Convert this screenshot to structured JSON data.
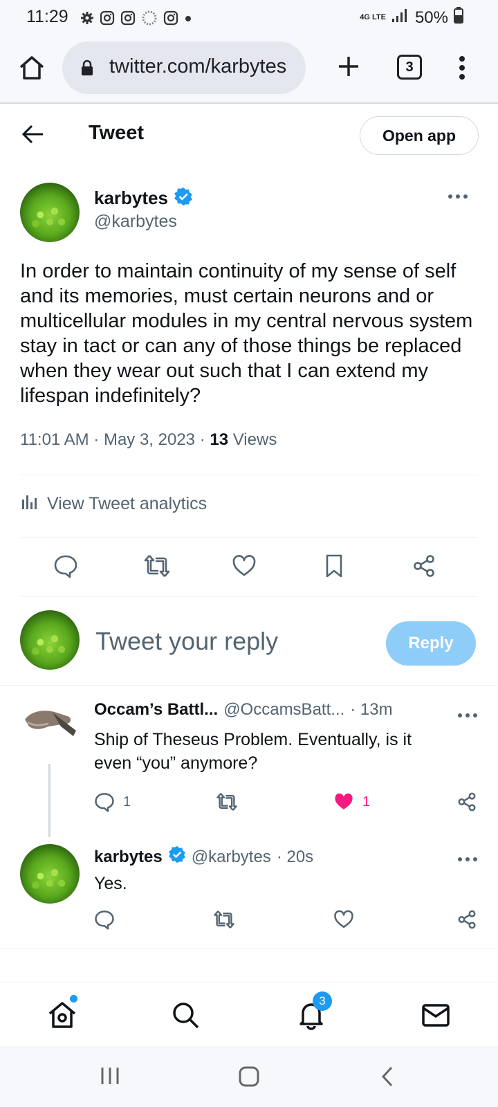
{
  "status_bar": {
    "time": "11:29",
    "network": "4G LTE",
    "battery": "50%",
    "notification_icons": [
      "gear-icon",
      "instagram-icon",
      "instagram-icon",
      "loading-icon",
      "instagram-icon",
      "dot-icon"
    ]
  },
  "browser": {
    "url": "twitter.com/karbytes",
    "tab_count": "3"
  },
  "header": {
    "title": "Tweet",
    "open_app_label": "Open app"
  },
  "tweet": {
    "author_name": "karbytes",
    "author_handle": "@karbytes",
    "text": "In order to maintain continuity of my sense of self and its memories, must certain neurons and or multicellular modules in my central nervous system stay in tact or can any of those things be replaced when they wear out such that I can extend my lifespan indefinitely?",
    "timestamp": "11:01 AM · May 3, 2023 · ",
    "views_count": "13",
    "views_label": " Views",
    "analytics_label": "View Tweet analytics"
  },
  "composer": {
    "placeholder": "Tweet your reply",
    "reply_label": "Reply"
  },
  "replies": [
    {
      "name": "Occam’s Battl...",
      "handle": "@OccamsBatt...",
      "time": "· 13m",
      "text": "Ship of Theseus Problem.  Eventually, is it even “you” anymore?",
      "reply_count": "1",
      "like_count": "1"
    },
    {
      "name": "karbytes",
      "handle": "@karbytes",
      "time": "· 20s",
      "text": "Yes."
    }
  ],
  "bottom_nav": {
    "notification_badge": "3"
  },
  "colors": {
    "accent": "#1d9bf0",
    "like": "#f91880",
    "muted": "#536471",
    "reply_button": "#8ecdf8"
  }
}
